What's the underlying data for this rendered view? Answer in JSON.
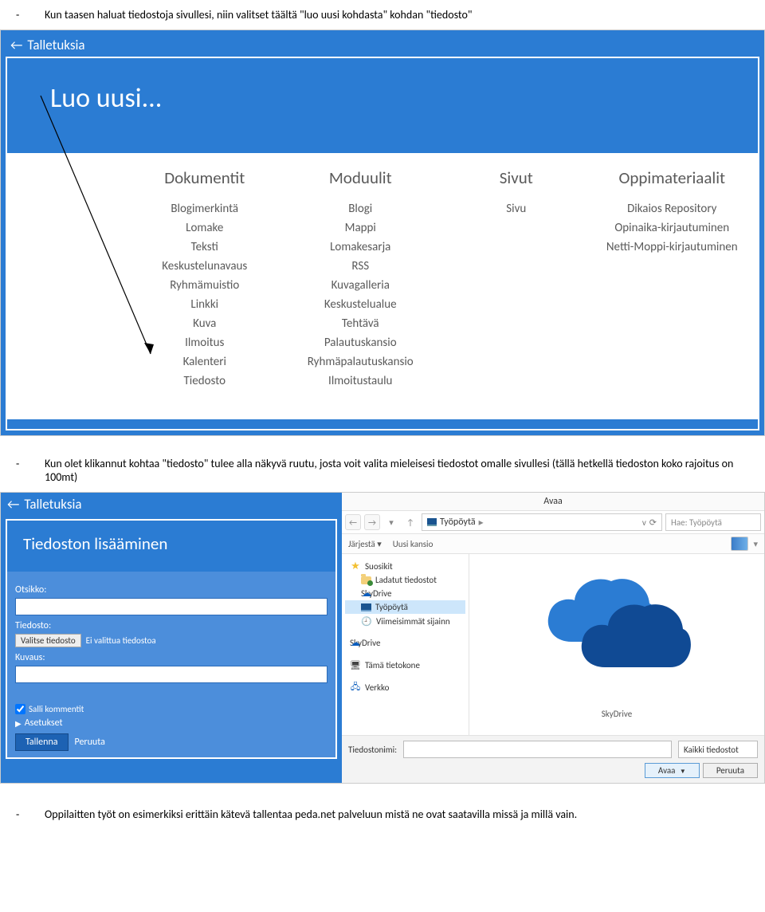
{
  "bullets": {
    "b1": "Kun taasen haluat tiedostoja sivullesi, niin valitset täältä \"luo uusi kohdasta\" kohdan \"tiedosto\"",
    "b2": "Kun olet klikannut kohtaa \"tiedosto\" tulee alla näkyvä ruutu, josta voit valita mieleisesi tiedostot omalle sivullesi (tällä hetkellä tiedoston koko rajoitus on 100mt)",
    "b3": "Oppilaitten työt on esimerkiksi erittäin kätevä tallentaa peda.net palveluun mistä ne ovat saatavilla missä ja millä vain."
  },
  "screenshot1": {
    "back_label": "Talletuksia",
    "panel_title": "Luo uusi...",
    "columns": [
      {
        "heading": "Dokumentit",
        "items": [
          "Blogimerkintä",
          "Lomake",
          "Teksti",
          "Keskustelunavaus",
          "Ryhmämuistio",
          "Linkki",
          "Kuva",
          "Ilmoitus",
          "Kalenteri",
          "Tiedosto"
        ]
      },
      {
        "heading": "Moduulit",
        "items": [
          "Blogi",
          "Mappi",
          "Lomakesarja",
          "RSS",
          "Kuvagalleria",
          "Keskustelualue",
          "Tehtävä",
          "Palautuskansio",
          "Ryhmäpalautuskansio",
          "Ilmoitustaulu"
        ]
      },
      {
        "heading": "Sivut",
        "items": [
          "Sivu"
        ]
      },
      {
        "heading": "Oppimateriaalit",
        "items": [
          "Dikaios Repository",
          "Opinaika-kirjautuminen",
          "Netti-Moppi-kirjautuminen"
        ]
      }
    ]
  },
  "screenshot2": {
    "back_label": "Talletuksia",
    "form_title": "Tiedoston lisääminen",
    "labels": {
      "otsikko": "Otsikko:",
      "tiedosto": "Tiedosto:",
      "kuvaus": "Kuvaus:",
      "valitse": "Valitse tiedosto",
      "no_file": "Ei valittua tiedostoa",
      "salli": "Salli kommentit",
      "asetukset": "Asetukset",
      "tallenna": "Tallenna",
      "peruuta": "Peruuta"
    },
    "dialog": {
      "title": "Avaa",
      "crumb": "Työpöytä",
      "search_placeholder": "Hae: Työpöytä",
      "toolbar": {
        "left1": "Järjestä",
        "left2": "Uusi kansio"
      },
      "tree": {
        "fav": "Suosikit",
        "downloads": "Ladatut tiedostot",
        "skydrive": "SkyDrive",
        "desktop": "Työpöytä",
        "recent": "Viimeisimmät sijainn",
        "skydrive2": "SkyDrive",
        "pc": "Tämä tietokone",
        "network": "Verkko"
      },
      "main_caption": "SkyDrive",
      "footer": {
        "filename_label": "Tiedostonimi:",
        "filetype": "Kaikki tiedostot",
        "open": "Avaa",
        "cancel": "Peruuta"
      }
    }
  }
}
